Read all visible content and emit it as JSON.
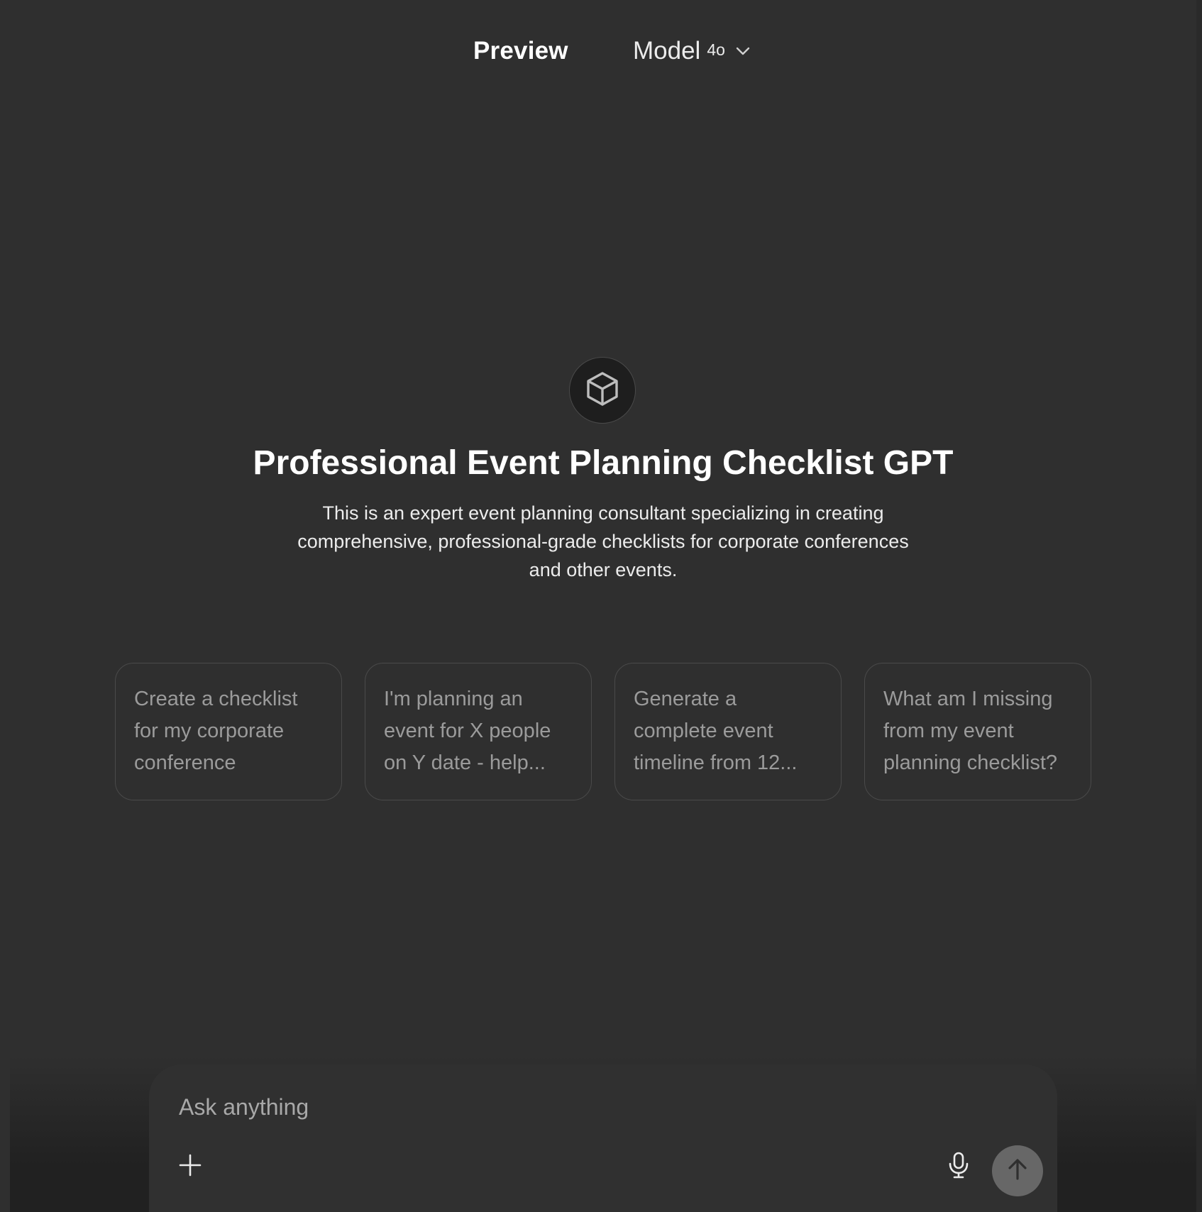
{
  "header": {
    "preview_label": "Preview",
    "model_label": "Model",
    "model_version": "4o"
  },
  "hero": {
    "icon": "cube-icon",
    "title": "Professional Event Planning Checklist GPT",
    "description": "This is an expert event planning consultant specializing in creating comprehensive, professional-grade checklists for corporate conferences and other events."
  },
  "suggestions": [
    {
      "text": "Create a checklist for my corporate conference"
    },
    {
      "text": "I'm planning an event for X people on Y date - help..."
    },
    {
      "text": "Generate a complete event timeline from 12..."
    },
    {
      "text": "What am I missing from my event planning checklist?"
    }
  ],
  "composer": {
    "placeholder": "Ask anything",
    "value": "",
    "icons": {
      "attach": "plus-icon",
      "voice": "microphone-icon",
      "send": "arrow-up-icon"
    }
  },
  "colors": {
    "background": "#2f2f2f",
    "composer_background": "#303030",
    "send_button": "#676767",
    "card_border": "#4a4a4a",
    "card_text": "#9b9b9b"
  }
}
